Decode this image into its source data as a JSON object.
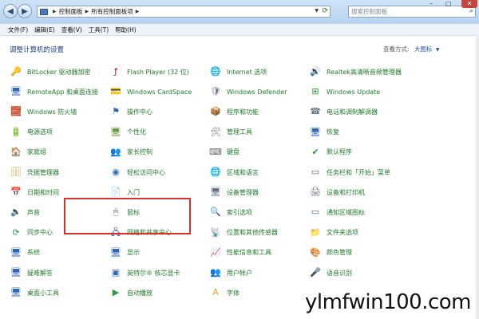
{
  "address": {
    "crumbs": [
      "控制面板",
      "所有控制面板项"
    ]
  },
  "search": {
    "placeholder": "搜索控制面板"
  },
  "menu": [
    "文件(F)",
    "编辑(E)",
    "查看(V)",
    "工具(T)",
    "帮助(H)"
  ],
  "header": {
    "title": "调整计算机的设置",
    "view_by_label": "查看方式:",
    "view_by_value": "大图标"
  },
  "items": [
    {
      "label": "BitLocker 驱动器加密",
      "icon": "bitlocker-icon",
      "glyph": "🔑",
      "color": "#8a8f99"
    },
    {
      "label": "RemoteApp 和桌面连接",
      "icon": "remoteapp-icon",
      "glyph": "🖥",
      "color": "#2f67b5"
    },
    {
      "label": "Windows 防火墙",
      "icon": "firewall-icon",
      "glyph": "🧱",
      "color": "#b8462b"
    },
    {
      "label": "电源选项",
      "icon": "power-options-icon",
      "glyph": "🔋",
      "color": "#3d8a3d"
    },
    {
      "label": "家庭组",
      "icon": "homegroup-icon",
      "glyph": "🏠",
      "color": "#3a7fc4"
    },
    {
      "label": "凭据管理器",
      "icon": "credential-manager-icon",
      "glyph": "🗄",
      "color": "#d9a441"
    },
    {
      "label": "日期和时间",
      "icon": "date-time-icon",
      "glyph": "📅",
      "color": "#3a7fc4"
    },
    {
      "label": "声音",
      "icon": "sound-icon",
      "glyph": "🔈",
      "color": "#6b6b6b"
    },
    {
      "label": "同步中心",
      "icon": "sync-center-icon",
      "glyph": "⟳",
      "color": "#2a9a3a"
    },
    {
      "label": "系统",
      "icon": "system-icon",
      "glyph": "🖥",
      "color": "#2f67b5"
    },
    {
      "label": "疑难解答",
      "icon": "troubleshooting-icon",
      "glyph": "🖥",
      "color": "#2f67b5"
    },
    {
      "label": "桌面小工具",
      "icon": "desktop-gadgets-icon",
      "glyph": "🖥",
      "color": "#2f67b5"
    },
    {
      "label": "Flash Player (32 位)",
      "icon": "flash-player-icon",
      "glyph": "ƒ",
      "color": "#8b1c12"
    },
    {
      "label": "Windows CardSpace",
      "icon": "cardspace-icon",
      "glyph": "💳",
      "color": "#4d7fbf"
    },
    {
      "label": "操作中心",
      "icon": "action-center-icon",
      "glyph": "⚑",
      "color": "#2f67b5"
    },
    {
      "label": "个性化",
      "icon": "personalization-icon",
      "glyph": "🖥",
      "color": "#6a9c3c"
    },
    {
      "label": "家长控制",
      "icon": "parental-controls-icon",
      "glyph": "👥",
      "color": "#d07a2a"
    },
    {
      "label": "轻松访问中心",
      "icon": "ease-of-access-icon",
      "glyph": "◉",
      "color": "#2f67b5"
    },
    {
      "label": "入门",
      "icon": "getting-started-icon",
      "glyph": "📄",
      "color": "#7a8a9a"
    },
    {
      "label": "鼠标",
      "icon": "mouse-icon",
      "glyph": "🖱",
      "color": "#777777"
    },
    {
      "label": "网络和共享中心",
      "icon": "network-sharing-icon",
      "glyph": "🖧",
      "color": "#2f67b5"
    },
    {
      "label": "显示",
      "icon": "display-icon",
      "glyph": "🖥",
      "color": "#2f67b5"
    },
    {
      "label": "英特尔® 核芯显卡",
      "icon": "intel-graphics-icon",
      "glyph": "▣",
      "color": "#2f67b5"
    },
    {
      "label": "自动播放",
      "icon": "autoplay-icon",
      "glyph": "▶",
      "color": "#2a9a3a"
    },
    {
      "label": "Internet 选项",
      "icon": "internet-options-icon",
      "glyph": "🌐",
      "color": "#2f67b5"
    },
    {
      "label": "Windows Defender",
      "icon": "windows-defender-icon",
      "glyph": "🛡",
      "color": "#6b7480"
    },
    {
      "label": "程序和功能",
      "icon": "programs-features-icon",
      "glyph": "📦",
      "color": "#6b7480"
    },
    {
      "label": "管理工具",
      "icon": "admin-tools-icon",
      "glyph": "🛠",
      "color": "#6b7480"
    },
    {
      "label": "键盘",
      "icon": "keyboard-icon",
      "glyph": "⌨",
      "color": "#6b6b6b"
    },
    {
      "label": "区域和语言",
      "icon": "region-language-icon",
      "glyph": "🌐",
      "color": "#2f67b5"
    },
    {
      "label": "设备管理器",
      "icon": "device-manager-icon",
      "glyph": "🖥",
      "color": "#6b7480"
    },
    {
      "label": "索引选项",
      "icon": "indexing-options-icon",
      "glyph": "🔍",
      "color": "#6b7480"
    },
    {
      "label": "位置和其他传感器",
      "icon": "location-sensors-icon",
      "glyph": "📡",
      "color": "#6b7480"
    },
    {
      "label": "性能信息和工具",
      "icon": "performance-tools-icon",
      "glyph": "📈",
      "color": "#2a7a3a"
    },
    {
      "label": "用户帐户",
      "icon": "user-accounts-icon",
      "glyph": "👥",
      "color": "#3a7fc4"
    },
    {
      "label": "字体",
      "icon": "fonts-icon",
      "glyph": "A",
      "color": "#d9a441"
    },
    {
      "label": "Realtek高清晰音频管理器",
      "icon": "realtek-audio-icon",
      "glyph": "🔊",
      "color": "#3a5f8a"
    },
    {
      "label": "Windows Update",
      "icon": "windows-update-icon",
      "glyph": "⊞",
      "color": "#2a9a3a"
    },
    {
      "label": "电话和调制解调器",
      "icon": "phone-modem-icon",
      "glyph": "☎",
      "color": "#6b7480"
    },
    {
      "label": "恢复",
      "icon": "recovery-icon",
      "glyph": "🖥",
      "color": "#2f67b5"
    },
    {
      "label": "默认程序",
      "icon": "default-programs-icon",
      "glyph": "✔",
      "color": "#2a9a3a"
    },
    {
      "label": "任务栏和「开始」菜单",
      "icon": "taskbar-start-icon",
      "glyph": "▭",
      "color": "#4d6a8a"
    },
    {
      "label": "设备和打印机",
      "icon": "devices-printers-icon",
      "glyph": "🖨",
      "color": "#6b7480"
    },
    {
      "label": "通知区域图标",
      "icon": "notification-icons-icon",
      "glyph": "▭",
      "color": "#4d6a8a"
    },
    {
      "label": "文件夹选项",
      "icon": "folder-options-icon",
      "glyph": "📁",
      "color": "#d9a441"
    },
    {
      "label": "颜色管理",
      "icon": "color-management-icon",
      "glyph": "🎨",
      "color": "#c0392b"
    },
    {
      "label": "语音识别",
      "icon": "speech-recognition-icon",
      "glyph": "🎤",
      "color": "#6b7480"
    },
    {
      "label": "",
      "icon": "",
      "glyph": "",
      "color": "#000000"
    }
  ],
  "watermark": "ylmfwin100.com",
  "colors": {
    "link_green": "#1f7a2a",
    "title_blue": "#1e3a8a",
    "highlight_red": "#d9302c"
  }
}
